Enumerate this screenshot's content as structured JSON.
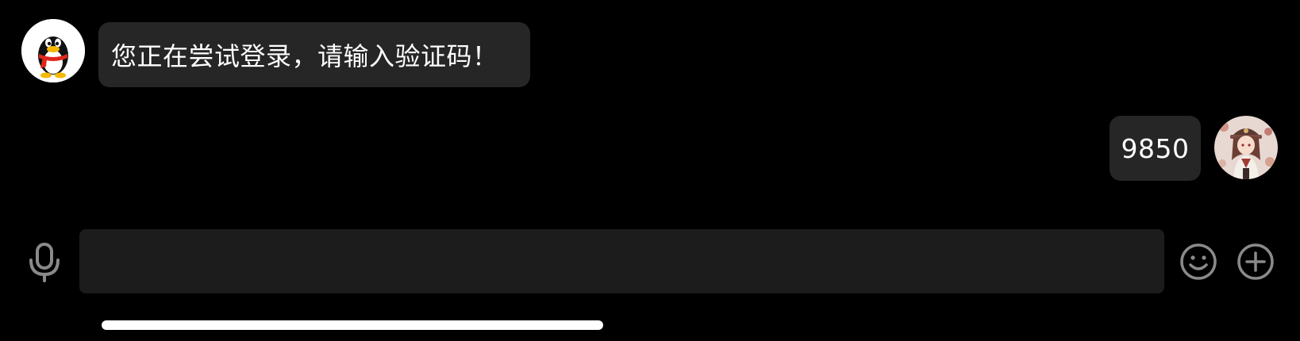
{
  "messages": [
    {
      "sender": "bot",
      "avatar_icon": "qq-penguin-icon",
      "text": "您正在尝试登录，请输入验证码！"
    },
    {
      "sender": "user",
      "avatar_icon": "anime-girl-avatar",
      "text": "9850"
    }
  ],
  "composer": {
    "value": "",
    "placeholder": "",
    "mic_icon": "microphone-icon",
    "emoji_icon": "smiley-face-icon",
    "plus_icon": "plus-circle-icon"
  },
  "colors": {
    "background": "#000000",
    "bubble": "#262626",
    "input": "#1c1c1c",
    "icon": "#8a8a8a",
    "text": "#ffffff"
  }
}
